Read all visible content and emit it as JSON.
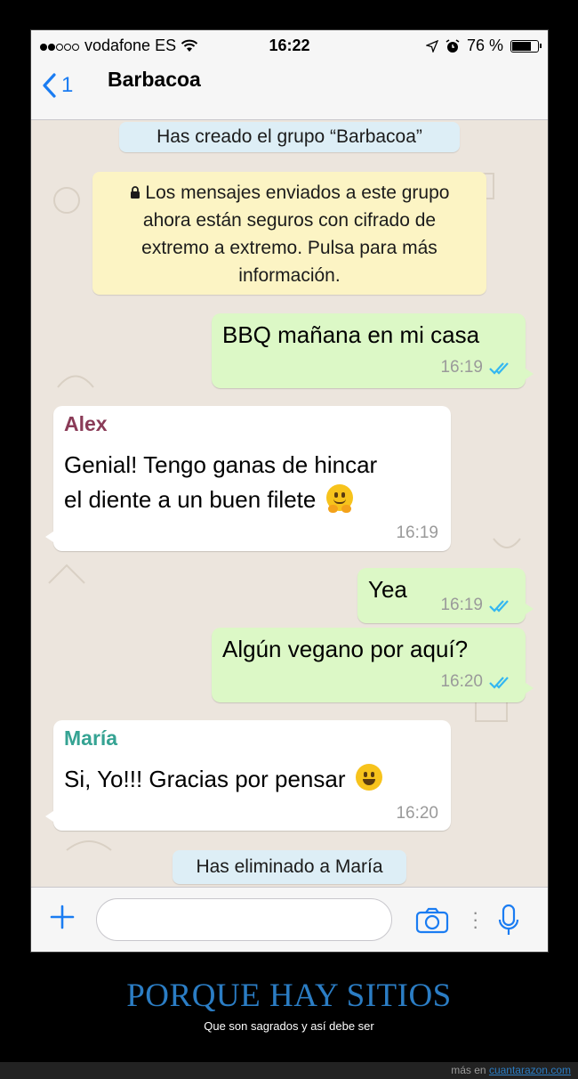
{
  "status_bar": {
    "carrier": "vodafone ES",
    "time": "16:22",
    "battery": "76 %",
    "battery_level": 0.76,
    "signal_icon": "signal-dots-icon",
    "wifi_icon": "wifi-icon",
    "location_icon": "location-arrow-icon",
    "alarm_icon": "alarm-clock-icon"
  },
  "header": {
    "back_count": "1",
    "title": "Barbacoa"
  },
  "chat": {
    "system_created": "Has creado el grupo “Barbacoa”",
    "encryption_lines": [
      "Los mensajes enviados a este grupo",
      "ahora están seguros con cifrado de",
      "extremo a extremo. Pulsa para más",
      "información."
    ],
    "messages": [
      {
        "direction": "out",
        "text": "BBQ mañana en mi casa",
        "time": "16:19",
        "read": true
      },
      {
        "direction": "in",
        "sender": "Alex",
        "lines": [
          "Genial! Tengo ganas de hincar",
          "el diente a un buen filete"
        ],
        "emoji": "hugging-face-emoji",
        "time": "16:19"
      },
      {
        "direction": "out",
        "text": "Yea",
        "time": "16:19",
        "read": true
      },
      {
        "direction": "out",
        "text": "Algún vegano por aquí?",
        "time": "16:20",
        "read": true
      },
      {
        "direction": "in",
        "sender": "María",
        "text": "Si, Yo!!! Gracias por pensar",
        "emoji": "grinning-face-emoji",
        "time": "16:20"
      }
    ],
    "system_removed": "Has eliminado a María"
  },
  "input_bar": {
    "placeholder": ""
  },
  "caption": {
    "title": "PORQUE HAY SITIOS",
    "subtitle": "Que son sagrados y así debe ser"
  },
  "footer": {
    "prefix": "más en",
    "link": "cuantarazon.com"
  },
  "colors": {
    "accent": "#1A7CF2",
    "outgoing_bubble": "#DCF8C6",
    "incoming_bubble": "#FFFFFF",
    "read_ticks": "#34B7F1",
    "alex_name": "#8A3B57",
    "maria_name": "#35A393",
    "caption_title": "#2B7DC4"
  }
}
